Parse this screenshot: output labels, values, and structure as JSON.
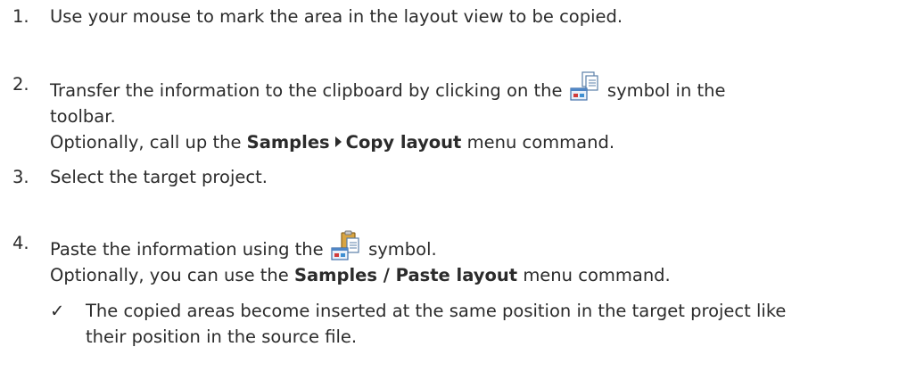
{
  "steps": [
    {
      "num": "1.",
      "text": "Use your mouse to mark the area in the layout view to be copied."
    },
    {
      "num": "2.",
      "line1_a": "Transfer the information to the clipboard by clicking on the",
      "line1_b": "symbol in the",
      "line2": "toolbar.",
      "line3_a": "Optionally, call up the",
      "menu_a": "Samples",
      "menu_b": "Copy layout",
      "line3_b": "menu command.",
      "icon": "copy-layout-icon"
    },
    {
      "num": "3.",
      "text": "Select the target project."
    },
    {
      "num": "4.",
      "line1_a": "Paste the information using the",
      "line1_b": "symbol.",
      "line2_a": "Optionally, you can use the",
      "menu": "Samples / Paste layout",
      "line2_b": "menu command.",
      "icon": "paste-layout-icon"
    }
  ],
  "result": {
    "check": "✓",
    "line1": "The copied areas become inserted at the same position in the target project like",
    "line2": "their position in the source file."
  }
}
